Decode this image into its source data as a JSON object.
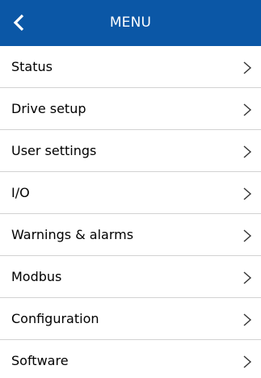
{
  "header": {
    "title": "MENU",
    "back_icon": "chevron-left-icon",
    "background_color": "#0b57a6"
  },
  "menu": {
    "items": [
      {
        "label": "Status",
        "icon": "chevron-right-icon"
      },
      {
        "label": "Drive setup",
        "icon": "chevron-right-icon"
      },
      {
        "label": "User settings",
        "icon": "chevron-right-icon"
      },
      {
        "label": "I/O",
        "icon": "chevron-right-icon"
      },
      {
        "label": "Warnings & alarms",
        "icon": "chevron-right-icon"
      },
      {
        "label": "Modbus",
        "icon": "chevron-right-icon"
      },
      {
        "label": "Configuration",
        "icon": "chevron-right-icon"
      },
      {
        "label": "Software",
        "icon": "chevron-right-icon"
      }
    ]
  }
}
